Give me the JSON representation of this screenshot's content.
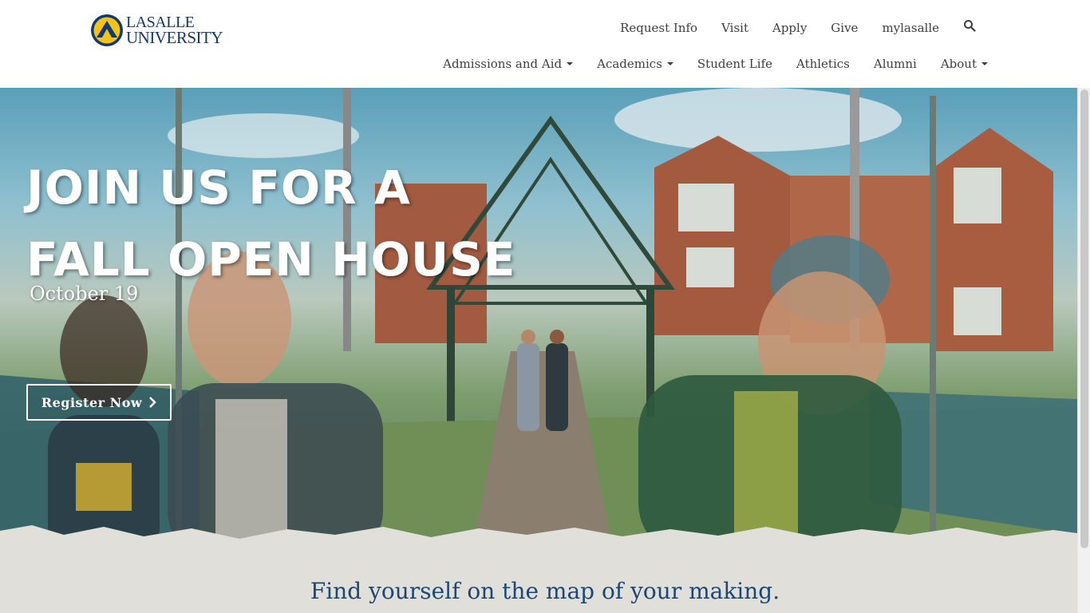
{
  "brand": {
    "logo_top": "LASALLE",
    "logo_bottom": "UNIVERSITY",
    "primary_color": "#15386a",
    "accent_color": "#f2c318"
  },
  "utility_nav": {
    "items": [
      {
        "label": "Request Info"
      },
      {
        "label": "Visit"
      },
      {
        "label": "Apply"
      },
      {
        "label": "Give"
      },
      {
        "label": "mylasalle"
      }
    ],
    "search_icon": "search-icon"
  },
  "main_nav": {
    "items": [
      {
        "label": "Admissions and Aid",
        "has_dropdown": true
      },
      {
        "label": "Academics",
        "has_dropdown": true
      },
      {
        "label": "Student Life",
        "has_dropdown": false
      },
      {
        "label": "Athletics",
        "has_dropdown": false
      },
      {
        "label": "Alumni",
        "has_dropdown": false
      },
      {
        "label": "About",
        "has_dropdown": true
      }
    ]
  },
  "hero": {
    "title_line1": "JOIN US FOR A",
    "title_line2": "FALL OPEN HOUSE",
    "date": "October 19",
    "cta_label": "Register Now"
  },
  "band": {
    "tagline": "Find yourself on the map of your making."
  }
}
